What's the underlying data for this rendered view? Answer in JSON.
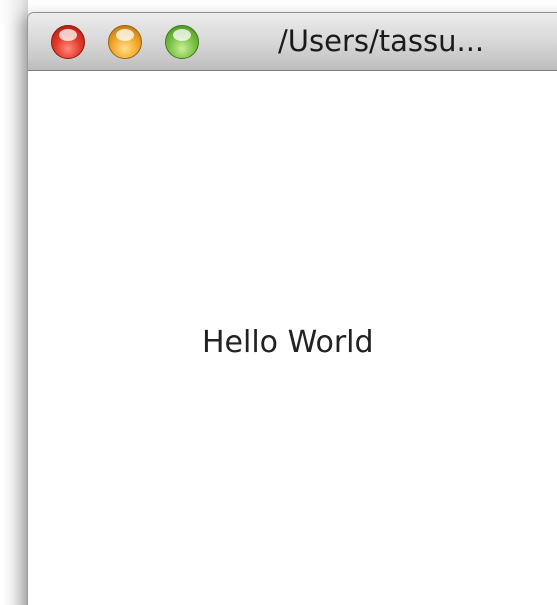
{
  "window": {
    "title": "/Users/tassu..."
  },
  "titlebar_buttons": {
    "close_color": "#e43b2b",
    "minimize_color": "#f2a92d",
    "zoom_color": "#7cc246"
  },
  "content": {
    "label": "Hello World"
  }
}
